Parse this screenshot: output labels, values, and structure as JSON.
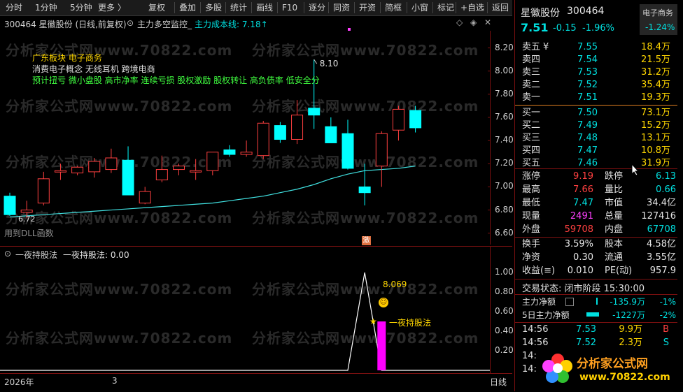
{
  "toolbar": {
    "left_items": [
      "分时",
      "1分钟",
      "5分钟",
      "更多 〉"
    ],
    "items": [
      "复权",
      "叠加",
      "多股",
      "统计",
      "画线",
      "F10",
      "逐分",
      "同资",
      "开资",
      "简框",
      "小窗",
      "标记",
      "+自选"
    ],
    "back": "返回"
  },
  "infobar": {
    "code_period": "300464 星徽股份 (日线,前复权)",
    "indicator": "主力多空监控_",
    "cost_line": "主力成本线: 7.18↑"
  },
  "main_chart": {
    "concept_title": "广东板块 电子商务",
    "concept_line2": "消费电子概念 无线耳机 跨境电商",
    "tags_line": "预计扭亏 微小盘股 高市净率 连续亏损 股权激励 股权转让 高负债率 低安全分",
    "high_label": "8.10",
    "low_label": "6.72",
    "footer_text": "用到DLL函数",
    "y_ticks": [
      "8.20",
      "8.00",
      "7.80",
      "7.60",
      "7.40",
      "7.20",
      "7.00",
      "6.80",
      "6.60"
    ],
    "watermark": "分析家公式网www.70822.com",
    "badge": "激"
  },
  "chart_data": {
    "type": "candlestick",
    "title": "300464 星徽股份 (日线,前复权)",
    "ylim": [
      6.55,
      8.3
    ],
    "candles": [
      {
        "o": 6.92,
        "h": 6.95,
        "l": 6.75,
        "c": 6.76
      },
      {
        "o": 6.78,
        "h": 6.88,
        "l": 6.73,
        "c": 6.8
      },
      {
        "o": 6.86,
        "h": 7.13,
        "l": 6.84,
        "c": 7.07
      },
      {
        "o": 7.14,
        "h": 7.2,
        "l": 7.06,
        "c": 7.14
      },
      {
        "o": 7.12,
        "h": 7.18,
        "l": 7.1,
        "c": 7.17
      },
      {
        "o": 7.13,
        "h": 7.25,
        "l": 7.08,
        "c": 7.22
      },
      {
        "o": 7.15,
        "h": 7.33,
        "l": 7.12,
        "c": 7.25
      },
      {
        "o": 7.23,
        "h": 7.35,
        "l": 6.93,
        "c": 6.93
      },
      {
        "o": 6.86,
        "h": 7.0,
        "l": 6.85,
        "c": 6.96
      },
      {
        "o": 7.06,
        "h": 7.27,
        "l": 7.04,
        "c": 7.15
      },
      {
        "o": 7.15,
        "h": 7.2,
        "l": 7.1,
        "c": 7.18
      },
      {
        "o": 7.14,
        "h": 7.24,
        "l": 7.06,
        "c": 7.14
      },
      {
        "o": 7.14,
        "h": 7.3,
        "l": 7.1,
        "c": 7.3
      },
      {
        "o": 7.32,
        "h": 7.36,
        "l": 7.26,
        "c": 7.28
      },
      {
        "o": 7.28,
        "h": 7.4,
        "l": 7.26,
        "c": 7.3
      },
      {
        "o": 7.27,
        "h": 7.57,
        "l": 7.24,
        "c": 7.55
      },
      {
        "o": 7.53,
        "h": 7.56,
        "l": 7.38,
        "c": 7.41
      },
      {
        "o": 7.41,
        "h": 7.75,
        "l": 7.37,
        "c": 7.62
      },
      {
        "o": 7.68,
        "h": 8.1,
        "l": 7.5,
        "c": 7.62
      },
      {
        "o": 7.52,
        "h": 7.6,
        "l": 7.38,
        "c": 7.38
      },
      {
        "o": 7.46,
        "h": 7.58,
        "l": 7.15,
        "c": 7.16
      },
      {
        "o": 7.0,
        "h": 7.2,
        "l": 6.84,
        "c": 6.95
      },
      {
        "o": 7.18,
        "h": 7.48,
        "l": 7.0,
        "c": 7.46
      },
      {
        "o": 7.49,
        "h": 7.7,
        "l": 7.4,
        "c": 7.67
      },
      {
        "o": 7.66,
        "h": 7.7,
        "l": 7.47,
        "c": 7.51
      }
    ],
    "ma_line": [
      6.74,
      6.75,
      6.76,
      6.77,
      6.78,
      6.79,
      6.8,
      6.81,
      6.82,
      6.83,
      6.84,
      6.85,
      6.86,
      6.88,
      6.9,
      6.92,
      6.95,
      6.98,
      7.02,
      7.07,
      7.11,
      7.14,
      7.15,
      7.16,
      7.18
    ]
  },
  "sub_chart": {
    "title": "一夜持股法",
    "value_label": "一夜持股法: 0.00",
    "y_ticks": [
      "1.00",
      "0.80",
      "0.60",
      "0.40",
      "0.20"
    ],
    "annotation": "8.069",
    "signal_label": "一夜持股法",
    "ylim": [
      0,
      1.1
    ]
  },
  "timebar": {
    "year": "2026年",
    "month": "3",
    "period": "日线"
  },
  "quote": {
    "name": "星徽股份",
    "code": "300464",
    "sector": "电子商务",
    "sector_change": "-1.24%",
    "price": "7.51",
    "change": "-0.15",
    "change_pct": "-1.96%",
    "asks": [
      {
        "label": "卖五",
        "mark": "¥",
        "price": "7.55",
        "vol": "18.4万"
      },
      {
        "label": "卖四",
        "mark": "",
        "price": "7.54",
        "vol": "21.5万"
      },
      {
        "label": "卖三",
        "mark": "",
        "price": "7.53",
        "vol": "31.2万"
      },
      {
        "label": "卖二",
        "mark": "",
        "price": "7.52",
        "vol": "35.4万"
      },
      {
        "label": "卖一",
        "mark": "",
        "price": "7.51",
        "vol": "19.3万"
      }
    ],
    "bids": [
      {
        "label": "买一",
        "price": "7.50",
        "vol": "73.1万"
      },
      {
        "label": "买二",
        "price": "7.49",
        "vol": "15.2万"
      },
      {
        "label": "买三",
        "price": "7.48",
        "vol": "13.1万"
      },
      {
        "label": "买四",
        "price": "7.47",
        "vol": "10.8万"
      },
      {
        "label": "买五",
        "price": "7.46",
        "vol": "31.9万"
      }
    ],
    "stats_a": [
      {
        "l1": "涨停",
        "v1": "9.19",
        "c1": "red",
        "l2": "跌停",
        "v2": "6.13",
        "c2": "green"
      },
      {
        "l1": "最高",
        "v1": "7.66",
        "c1": "red",
        "l2": "量比",
        "v2": "0.66",
        "c2": "green"
      },
      {
        "l1": "最低",
        "v1": "7.47",
        "c1": "green",
        "l2": "市值",
        "v2": "34.4亿",
        "c2": "white"
      },
      {
        "l1": "现量",
        "v1": "2491",
        "c1": "magenta",
        "l2": "总量",
        "v2": "127416",
        "c2": "white"
      },
      {
        "l1": "外盘",
        "v1": "59708",
        "c1": "red",
        "l2": "内盘",
        "v2": "67708",
        "c2": "green"
      }
    ],
    "stats_b": [
      {
        "l1": "换手",
        "v1": "3.59%",
        "l2": "股本",
        "v2": "4.58亿"
      },
      {
        "l1": "净资",
        "v1": "0.30",
        "l2": "流通",
        "v2": "3.55亿"
      },
      {
        "l1": "收益(≡)",
        "v1": "0.010",
        "l2": "PE(动)",
        "v2": "957.9"
      }
    ],
    "trade_state": "交易状态: 闭市阶段 15:30:00",
    "flow": [
      {
        "label": "主力净额",
        "value": "-135.9万",
        "pct": "-1%"
      },
      {
        "label": "5日主力净额",
        "value": "-1227万",
        "pct": "-2%"
      }
    ],
    "ticks": [
      {
        "time": "14:56",
        "price": "7.53",
        "vol": "9.9万",
        "side": "B"
      },
      {
        "time": "14:56",
        "price": "7.52",
        "vol": "2.3万",
        "side": "S"
      },
      {
        "time": "14:",
        "price": "",
        "vol": "",
        "side": ""
      },
      {
        "time": "14:",
        "price": "",
        "vol": "",
        "side": ""
      }
    ],
    "logo_text": "分析家公式网",
    "logo_url": "www.70822.com"
  }
}
